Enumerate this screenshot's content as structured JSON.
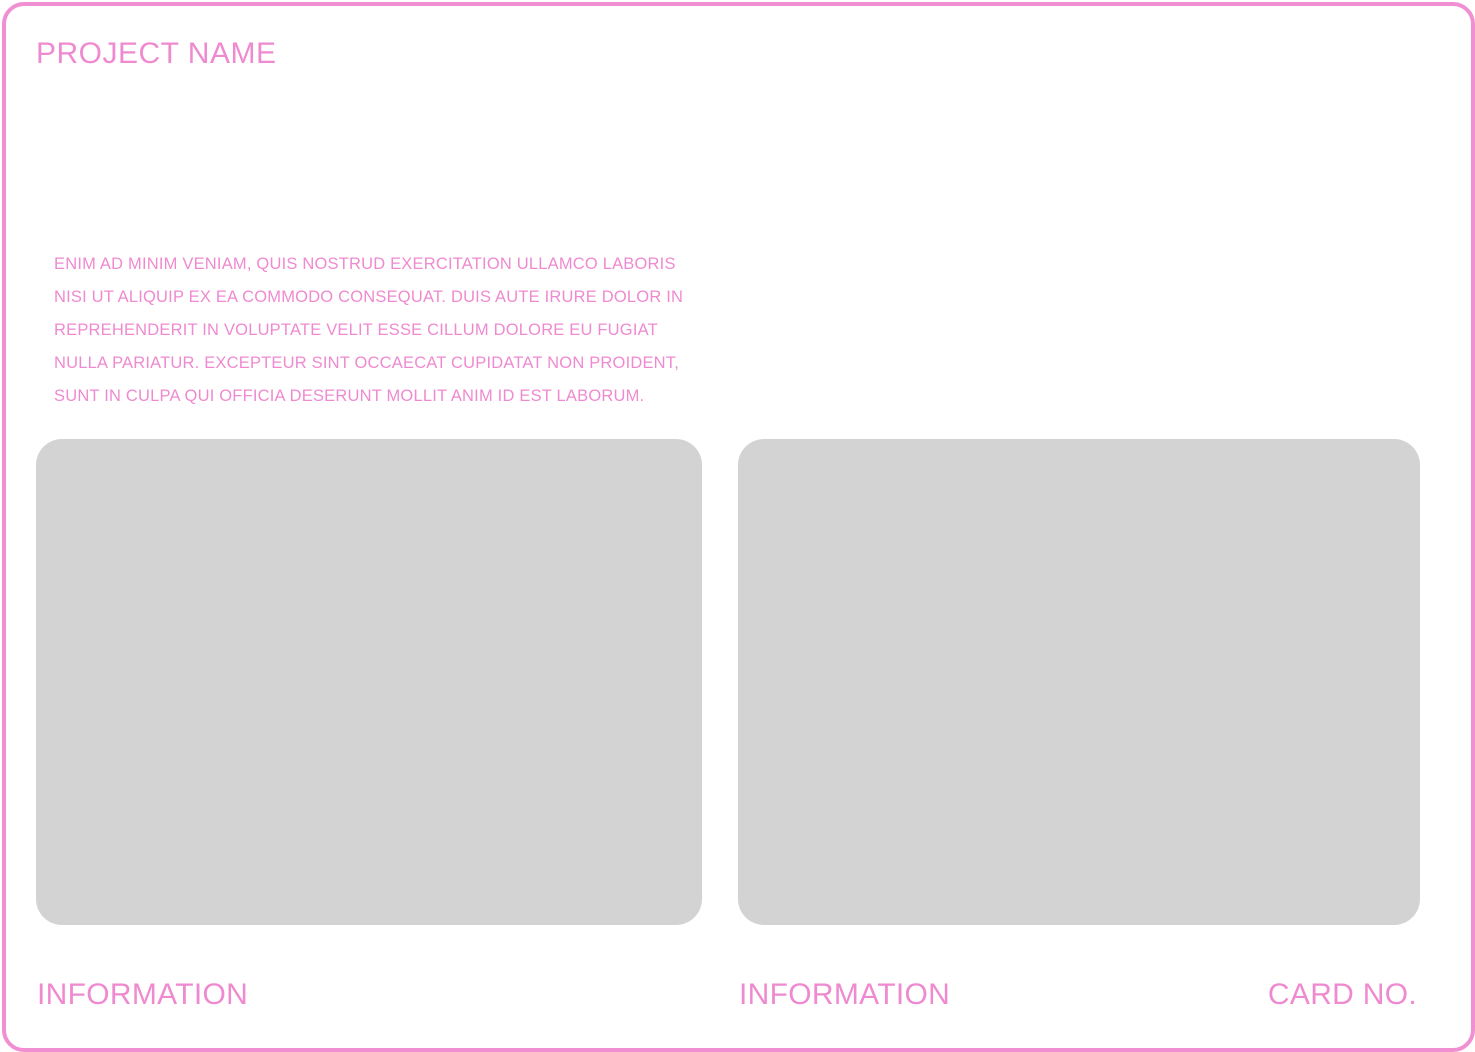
{
  "header": {
    "title": "PROJECT NAME"
  },
  "description": {
    "lines": [
      " ENIM AD MINIM VENIAM, QUIS NOSTRUD EXERCITATION ULLAMCO LABORIS",
      "NISI UT ALIQUIP EX EA COMMODO CONSEQUAT. DUIS AUTE IRURE DOLOR IN",
      "REPREHENDERIT IN VOLUPTATE VELIT ESSE CILLUM DOLORE EU FUGIAT",
      "NULLA PARIATUR. EXCEPTEUR SINT OCCAECAT CUPIDATAT NON PROIDENT,",
      "SUNT IN CULPA QUI OFFICIA DESERUNT MOLLIT ANIM ID EST LABORUM."
    ]
  },
  "footer": {
    "left_label": "INFORMATION",
    "right_label": "INFORMATION",
    "card_label": "CARD NO."
  },
  "colors": {
    "accent": "#ef8ad0",
    "border": "#f08fd1",
    "placeholder": "#d3d3d3",
    "background": "#ffffff"
  }
}
